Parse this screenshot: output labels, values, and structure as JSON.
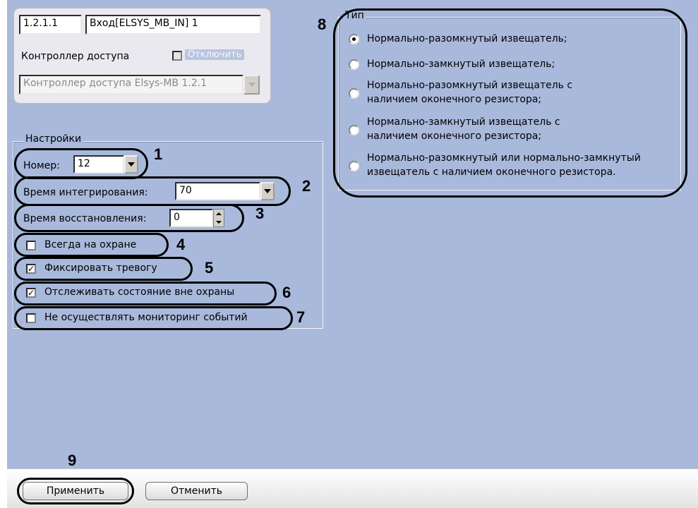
{
  "header": {
    "id_value": "1.2.1.1",
    "name_value": "Вход[ELSYS_MB_IN] 1",
    "controller_label": "Контроллер доступа",
    "disable_label": "Отключить",
    "controller_select": "Контроллер доступа Elsys-MB 1.2.1"
  },
  "settings": {
    "group_title": "Настройки",
    "number_label": "Номер:",
    "number_value": "12",
    "integration_label": "Время интегрирования:",
    "integration_value": "70",
    "recovery_label": "Время восстановления:",
    "recovery_value": "0",
    "always_armed_label": "Всегда на охране",
    "always_armed_checked": false,
    "fix_alarm_label": "Фиксировать тревогу",
    "fix_alarm_checked": true,
    "track_state_label": "Отслеживать состояние вне охраны",
    "track_state_checked": true,
    "no_monitoring_label": "Не осуществлять мониторинг событий",
    "no_monitoring_checked": false
  },
  "type_group": {
    "title": "Тип",
    "options": [
      {
        "line1": "Нормально-разомкнутый извещатель;",
        "line2": "",
        "selected": true
      },
      {
        "line1": "Нормально-замкнутый извещатель;",
        "line2": "",
        "selected": false
      },
      {
        "line1": "Нормально-разомкнутый извещатель с",
        "line2": "наличием оконечного резистора;",
        "selected": false
      },
      {
        "line1": "Нормально-замкнутый извещатель с",
        "line2": "наличием оконечного резистора;",
        "selected": false
      },
      {
        "line1": "Нормально-разомкнутый или нормально-замкнутый",
        "line2": "извещатель с наличием оконечного резистора.",
        "selected": false
      }
    ]
  },
  "annotations": [
    "1",
    "2",
    "3",
    "4",
    "5",
    "6",
    "7",
    "8",
    "9"
  ],
  "buttons": {
    "apply": "Применить",
    "cancel": "Отменить"
  },
  "colors": {
    "panel_bg": "#a9b9dc",
    "oval": "#000000"
  }
}
